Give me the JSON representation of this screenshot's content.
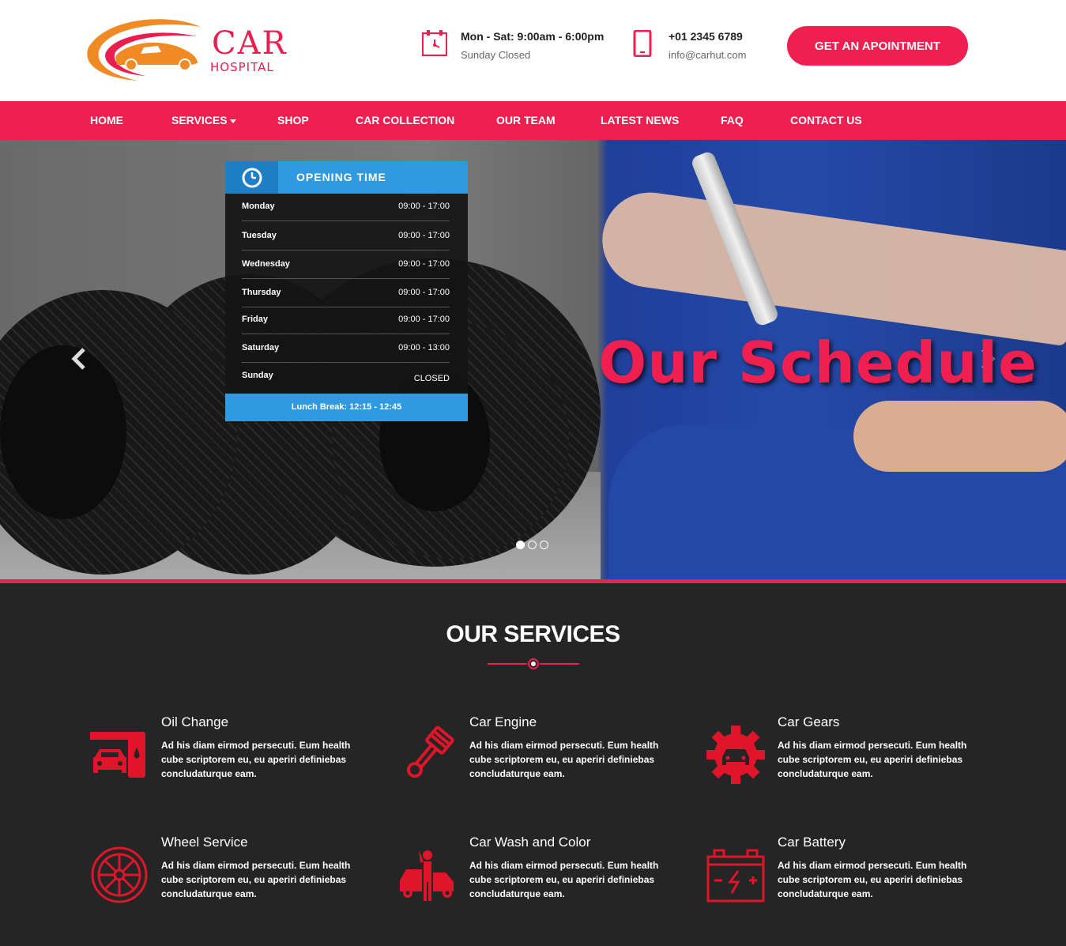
{
  "brand": {
    "name": "CAR",
    "tagline": "HOSPITAL"
  },
  "header": {
    "hours": {
      "line1": "Mon - Sat: 9:00am - 6:00pm",
      "line2": "Sunday Closed",
      "icon": "clock-icon"
    },
    "contact": {
      "phone": "+01 2345 6789",
      "email": "info@carhut.com",
      "icon": "phone-icon"
    },
    "appointment_button": "GET AN APOINTMENT"
  },
  "nav": {
    "items": [
      {
        "label": "HOME"
      },
      {
        "label": "SERVICES"
      },
      {
        "label": "SHOP"
      },
      {
        "label": "CAR COLLECTION"
      },
      {
        "label": "OUR TEAM"
      },
      {
        "label": "LATEST NEWS"
      },
      {
        "label": "FAQ"
      },
      {
        "label": "CONTACT US"
      }
    ]
  },
  "hero": {
    "title": "Our Schedule",
    "slide_count": 3,
    "active_slide": 1,
    "opening_time": {
      "title": "OPENING TIME",
      "rows": [
        {
          "day": "Monday",
          "time": "09:00 - 17:00"
        },
        {
          "day": "Tuesday",
          "time": "09:00 - 17:00"
        },
        {
          "day": "Wednesday",
          "time": "09:00 - 17:00"
        },
        {
          "day": "Thursday",
          "time": "09:00 - 17:00"
        },
        {
          "day": "Friday",
          "time": "09:00 - 17:00"
        },
        {
          "day": "Saturday",
          "time": "09:00 - 13:00"
        },
        {
          "day": "Sunday",
          "time": "CLOSED"
        }
      ],
      "footer": "Lunch Break: 12:15 - 12:45"
    }
  },
  "services": {
    "title": "OUR SERVICES",
    "items": [
      {
        "name": "Oil Change",
        "desc": "Ad his diam eirmod persecuti. Eum health cube scriptorem eu, eu aperiri definiebas concludaturque eam.",
        "icon": "oil-change-icon"
      },
      {
        "name": "Car Engine",
        "desc": "Ad his diam eirmod persecuti. Eum health cube scriptorem eu, eu aperiri definiebas concludaturque eam.",
        "icon": "piston-icon"
      },
      {
        "name": "Car Gears",
        "desc": "Ad his diam eirmod persecuti. Eum health cube scriptorem eu, eu aperiri definiebas concludaturque eam.",
        "icon": "gear-car-icon"
      },
      {
        "name": "Wheel Service",
        "desc": "Ad his diam eirmod persecuti. Eum health cube scriptorem eu, eu aperiri definiebas concludaturque eam.",
        "icon": "wheel-icon"
      },
      {
        "name": "Car Wash and Color",
        "desc": "Ad his diam eirmod persecuti. Eum health cube scriptorem eu, eu aperiri definiebas concludaturque eam.",
        "icon": "car-wash-icon"
      },
      {
        "name": "Car Battery",
        "desc": "Ad his diam eirmod persecuti. Eum health cube scriptorem eu, eu aperiri definiebas concludaturque eam.",
        "icon": "battery-icon"
      }
    ]
  },
  "colors": {
    "accent": "#ef1f4f",
    "blue": "#2f9ae0",
    "dark": "#252525",
    "logo_orange": "#f08a24"
  }
}
